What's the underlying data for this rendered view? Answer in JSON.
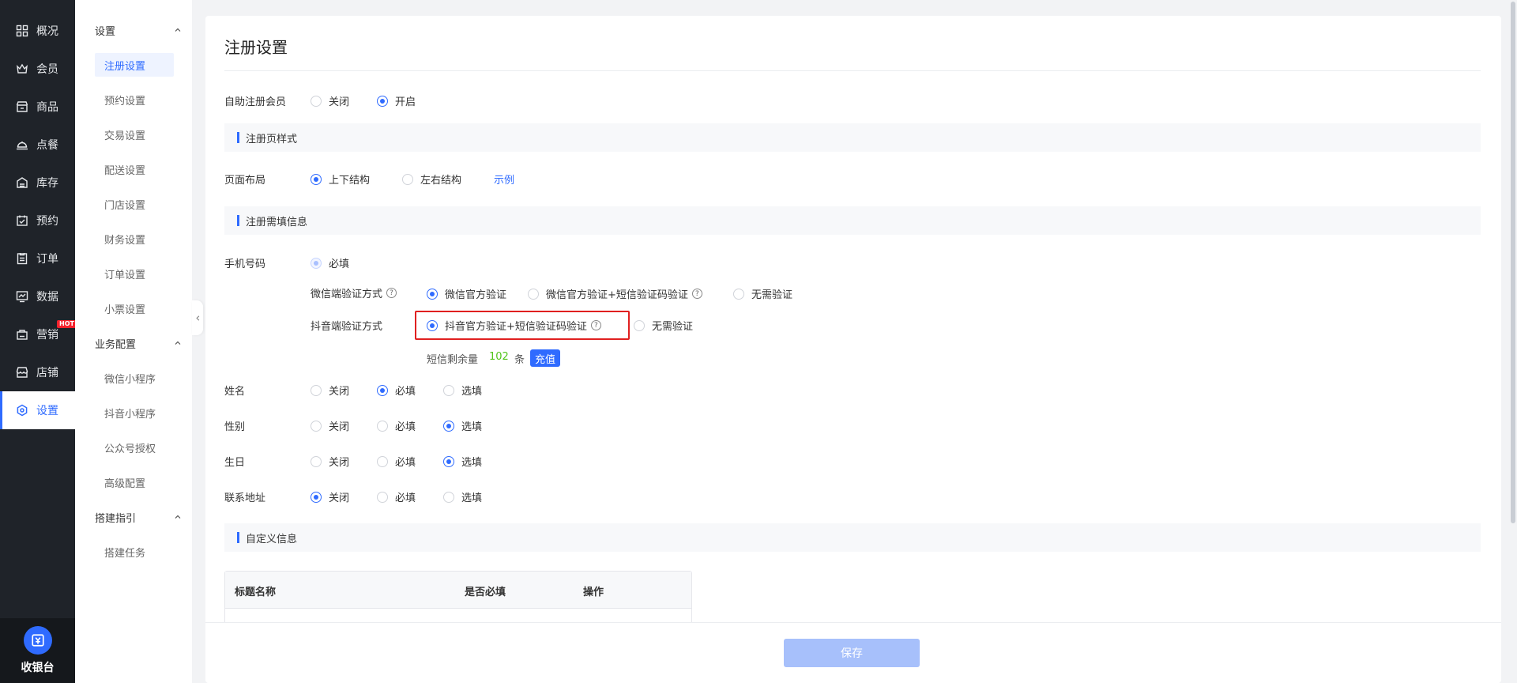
{
  "nav": {
    "items": [
      {
        "label": "概况",
        "icon": "grid-icon"
      },
      {
        "label": "会员",
        "icon": "crown-icon"
      },
      {
        "label": "商品",
        "icon": "store-icon"
      },
      {
        "label": "点餐",
        "icon": "cloche-icon"
      },
      {
        "label": "库存",
        "icon": "warehouse-icon"
      },
      {
        "label": "预约",
        "icon": "calendar-check-icon"
      },
      {
        "label": "订单",
        "icon": "order-list-icon"
      },
      {
        "label": "数据",
        "icon": "chart-icon"
      },
      {
        "label": "营销",
        "icon": "marketing-icon",
        "badge": "HOT"
      },
      {
        "label": "店铺",
        "icon": "shop-icon"
      },
      {
        "label": "设置",
        "icon": "gear-icon"
      }
    ],
    "active": "设置",
    "cashier_label": "收银台"
  },
  "subnav": {
    "groups": [
      {
        "title": "设置",
        "items": [
          "注册设置",
          "预约设置",
          "交易设置",
          "配送设置",
          "门店设置",
          "财务设置",
          "订单设置",
          "小票设置"
        ]
      },
      {
        "title": "业务配置",
        "items": [
          "微信小程序",
          "抖音小程序",
          "公众号授权",
          "高级配置"
        ]
      },
      {
        "title": "搭建指引",
        "items": [
          "搭建任务"
        ]
      }
    ],
    "active": "注册设置"
  },
  "page": {
    "title": "注册设置",
    "auto_register": {
      "label": "自助注册会员",
      "options": [
        "关闭",
        "开启"
      ],
      "selected": "开启"
    },
    "section_style": "注册页样式",
    "layout": {
      "label": "页面布局",
      "options": [
        "上下结构",
        "左右结构"
      ],
      "selected": "上下结构",
      "example_link": "示例"
    },
    "section_required": "注册需填信息",
    "phone": {
      "label": "手机号码",
      "required_option": "必填",
      "wechat_verify": {
        "label": "微信端验证方式",
        "options": [
          "微信官方验证",
          "微信官方验证+短信验证码验证",
          "无需验证"
        ],
        "selected": "微信官方验证"
      },
      "douyin_verify": {
        "label": "抖音端验证方式",
        "options": [
          "抖音官方验证+短信验证码验证",
          "无需验证"
        ],
        "selected": "抖音官方验证+短信验证码验证"
      },
      "sms": {
        "label": "短信剩余量",
        "count": "102",
        "unit": "条",
        "recharge_label": "充值"
      }
    },
    "fields": [
      {
        "label": "姓名",
        "options": [
          "关闭",
          "必填",
          "选填"
        ],
        "selected": "必填"
      },
      {
        "label": "性别",
        "options": [
          "关闭",
          "必填",
          "选填"
        ],
        "selected": "选填"
      },
      {
        "label": "生日",
        "options": [
          "关闭",
          "必填",
          "选填"
        ],
        "selected": "选填"
      },
      {
        "label": "联系地址",
        "options": [
          "关闭",
          "必填",
          "选填"
        ],
        "selected": "关闭"
      }
    ],
    "section_custom": "自定义信息",
    "table": {
      "headers": [
        "标题名称",
        "是否必填",
        "操作"
      ]
    },
    "save_label": "保存"
  },
  "colors": {
    "accent": "#2f6bff",
    "nav_bg": "#1f2329",
    "highlight_border": "#e02020",
    "sms_count": "#52c41a"
  }
}
